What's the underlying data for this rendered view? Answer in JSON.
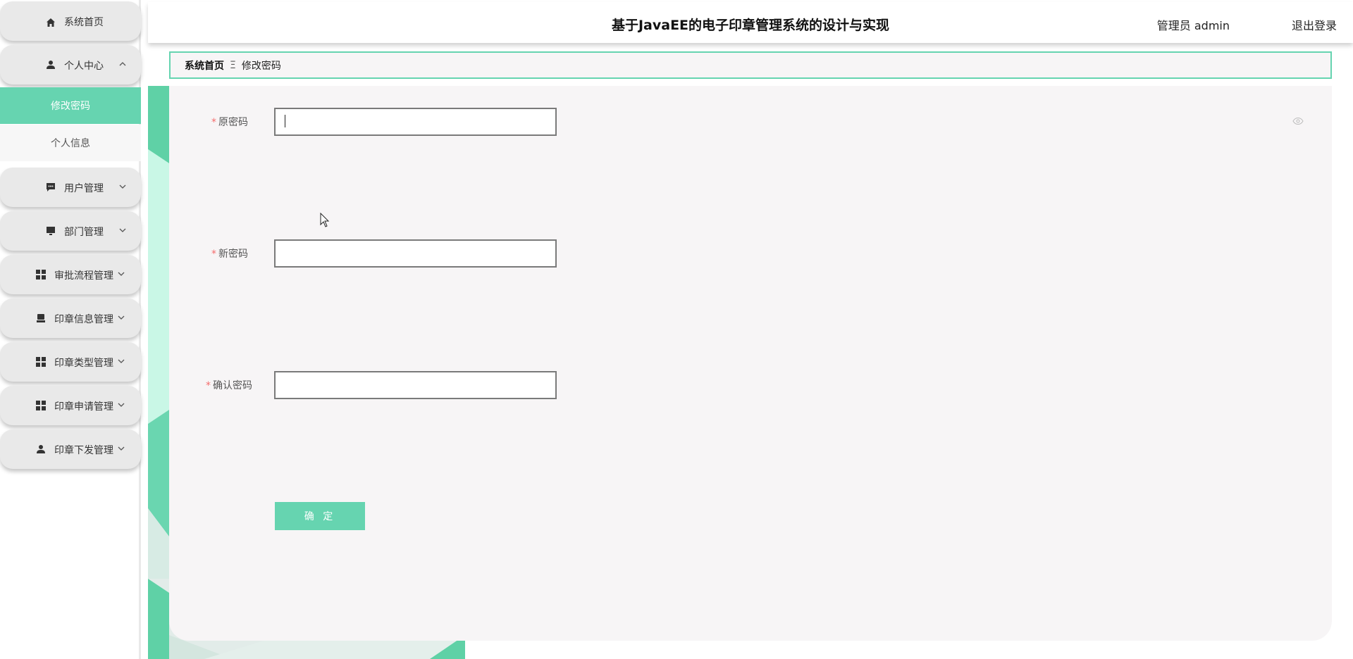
{
  "header": {
    "title": "基于JavaEE的电子印章管理系统的设计与实现",
    "user_label": "管理员 admin",
    "logout_label": "退出登录"
  },
  "sidebar": {
    "items": [
      {
        "label": "系统首页",
        "icon": "home-icon"
      },
      {
        "label": "个人中心",
        "icon": "user-icon",
        "expanded": true,
        "children": [
          {
            "label": "修改密码",
            "active": true
          },
          {
            "label": "个人信息"
          }
        ]
      },
      {
        "label": "用户管理",
        "icon": "chat-icon"
      },
      {
        "label": "部门管理",
        "icon": "monitor-icon"
      },
      {
        "label": "审批流程管理",
        "icon": "grid-icon"
      },
      {
        "label": "印章信息管理",
        "icon": "stamp-icon"
      },
      {
        "label": "印章类型管理",
        "icon": "grid-icon"
      },
      {
        "label": "印章申请管理",
        "icon": "grid-icon"
      },
      {
        "label": "印章下发管理",
        "icon": "person-icon"
      }
    ]
  },
  "breadcrumb": {
    "home": "系统首页",
    "separator": "Ξ",
    "current": "修改密码"
  },
  "form": {
    "required_mark": "*",
    "old_password_label": "原密码",
    "old_password_value": "",
    "new_password_label": "新密码",
    "new_password_value": "",
    "confirm_password_label": "确认密码",
    "confirm_password_value": "",
    "submit_label": "确 定"
  },
  "colors": {
    "accent": "#66d4b0",
    "menu_bg": "#e9e9e9",
    "panel_bg": "#f7f5f6",
    "required": "#f56c6c"
  }
}
